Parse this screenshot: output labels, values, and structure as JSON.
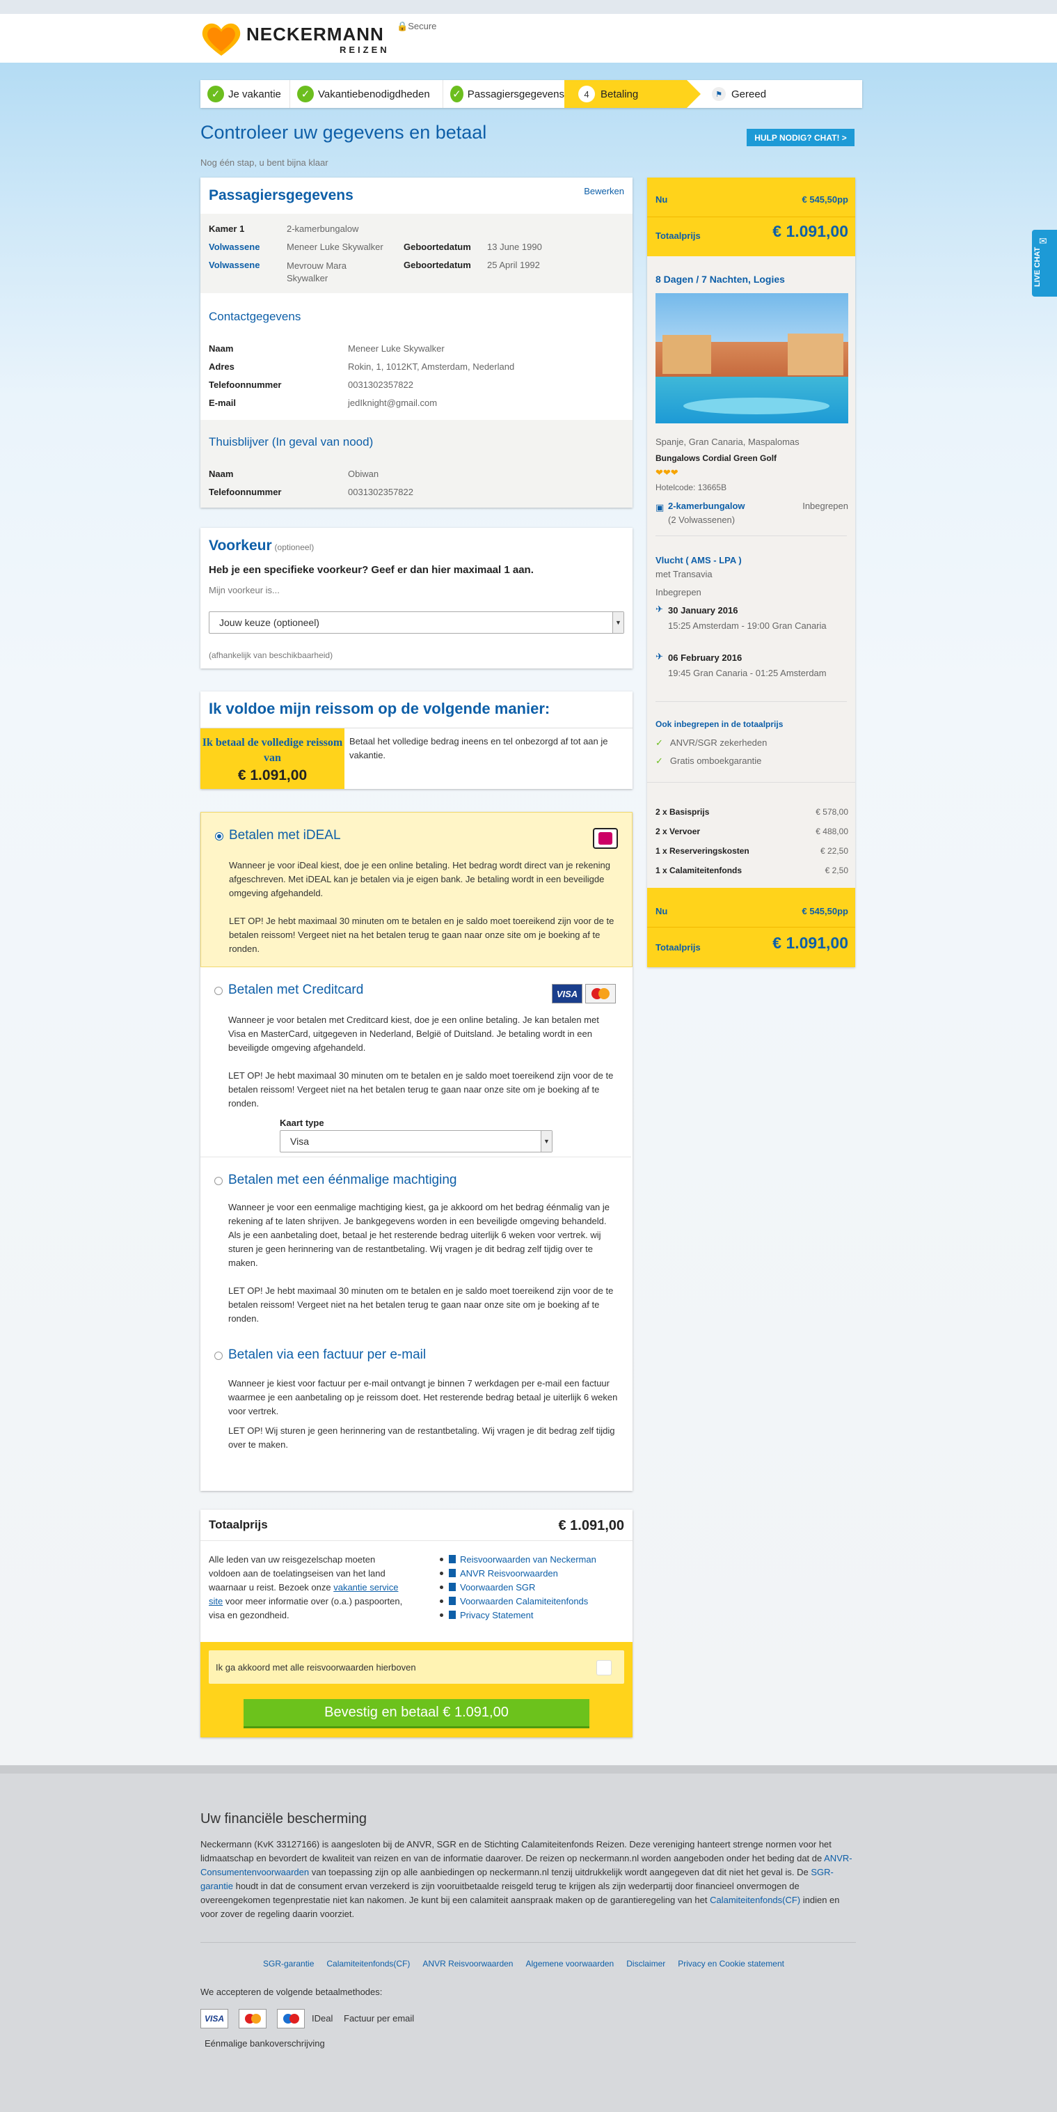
{
  "header": {
    "brand": "NECKERMANN",
    "brand_sub": "REIZEN",
    "secure": "Secure"
  },
  "steps": [
    {
      "label": "Je vakantie",
      "state": "done"
    },
    {
      "label": "Vakantiebenodigdheden",
      "state": "done"
    },
    {
      "label": "Passagiersgegevens",
      "state": "done"
    },
    {
      "label": "Betaling",
      "state": "active",
      "number": "4"
    },
    {
      "label": "Gereed",
      "state": "todo"
    }
  ],
  "page": {
    "title": "Controleer uw gegevens en betaal",
    "subtitle": "Nog één stap, u bent bijna klaar",
    "help": "HULP NODIG? CHAT! >"
  },
  "passengers": {
    "title": "Passagiersgegevens",
    "edit": "Bewerken",
    "room_label": "Kamer 1",
    "room_value": "2-kamerbungalow",
    "rows": [
      {
        "type": "Volwassene",
        "name": "Meneer Luke Skywalker",
        "dob_label": "Geboortedatum",
        "dob": "13 June 1990"
      },
      {
        "type": "Volwassene",
        "name": "Mevrouw Mara Skywalker",
        "dob_label": "Geboortedatum",
        "dob": "25 April 1992"
      }
    ],
    "contact_title": "Contactgegevens",
    "contact": [
      {
        "label": "Naam",
        "value": "Meneer Luke Skywalker"
      },
      {
        "label": "Adres",
        "value": "Rokin, 1, 1012KT, Amsterdam, Nederland"
      },
      {
        "label": "Telefoonnummer",
        "value": "0031302357822"
      },
      {
        "label": "E-mail",
        "value": "jedIknight@gmail.com"
      }
    ],
    "home_title": "Thuisblijver (In geval van nood)",
    "home": [
      {
        "label": "Naam",
        "value": "Obiwan"
      },
      {
        "label": "Telefoonnummer",
        "value": "0031302357822"
      }
    ]
  },
  "preference": {
    "title": "Voorkeur",
    "optional": "(optioneel)",
    "question": "Heb je een specifieke voorkeur? Geef er dan hier maximaal 1 aan.",
    "label": "Mijn voorkeur is...",
    "select": "Jouw keuze (optioneel)",
    "note": "(afhankelijk van beschikbaarheid)"
  },
  "fulfil": {
    "title": "Ik voldoe mijn reissom op de volgende manier:",
    "option_title": "Ik betaal de volledige reissom van",
    "option_amount": "€ 1.091,00",
    "option_text": "Betaal het volledige bedrag ineens en tel onbezorgd af tot aan je vakantie."
  },
  "payments": [
    {
      "title": "Betalen met iDEAL",
      "selected": true,
      "icon": "ideal-logo",
      "p1": "Wanneer je voor iDeal kiest, doe je een online betaling. Het bedrag wordt direct van je rekening afgeschreven. Met iDEAL kan je betalen via je eigen bank. Je betaling wordt in een beveiligde omgeving afgehandeld.",
      "p2": "LET OP! Je hebt maximaal 30 minuten om te betalen en je saldo moet toereikend zijn voor de te betalen reissom! Vergeet niet na het betalen terug te gaan naar onze site om je boeking af te ronden."
    },
    {
      "title": "Betalen met Creditcard",
      "selected": false,
      "icon": "visa-mastercard-logos",
      "p1": "Wanneer je voor betalen met Creditcard kiest, doe je een online betaling. Je kan betalen met Visa en MasterCard, uitgegeven in Nederland, België of Duitsland. Je betaling wordt in een beveiligde omgeving afgehandeld.",
      "p2": "LET OP! Je hebt maximaal 30 minuten om te betalen en je saldo moet toereikend zijn voor de te betalen reissom! Vergeet niet na het betalen terug te gaan naar onze site om je boeking af te ronden.",
      "card_label": "Kaart type",
      "card_value": "Visa"
    },
    {
      "title": "Betalen met een éénmalige machtiging",
      "selected": false,
      "p1": "Wanneer je voor een eenmalige machtiging kiest, ga je akkoord om het bedrag éénmalig van je rekening af te laten shrijven. Je bankgegevens worden in een beveiligde omgeving behandeld. Als je een aanbetaling doet, betaal je het resterende bedrag uiterlijk 6 weken voor vertrek. wij sturen je geen herinnering van de restantbetaling. Wij vragen je dit bedrag zelf tijdig over te maken.",
      "p2": "LET OP! Je hebt maximaal 30 minuten om te betalen en je saldo moet toereikend zijn voor de te betalen reissom! Vergeet niet na het betalen terug te gaan naar onze site om je boeking af te ronden."
    },
    {
      "title": "Betalen via een factuur per e-mail",
      "selected": false,
      "p1": "Wanneer je kiest voor factuur per e-mail ontvangt je binnen 7 werkdagen per e-mail een factuur waarmee je een aanbetaling op je reissom doet. Het resterende bedrag betaal je uiterlijk 6 weken voor vertrek.",
      "p2": "LET OP! Wij sturen je geen herinnering van de restantbetaling. Wij vragen je dit bedrag zelf tijdig over te maken."
    }
  ],
  "total": {
    "label": "Totaalprijs",
    "amount": "€ 1.091,00",
    "text_before": "Alle leden van uw reisgezelschap moeten voldoen aan de toelatingseisen van het land waarnaar u reist. Bezoek onze ",
    "text_link": "vakantie service site",
    "text_after": " voor meer informatie over (o.a.) paspoorten, visa en gezondheid.",
    "links": [
      "Reisvoorwaarden van Neckerman",
      "ANVR Reisvoorwaarden",
      "Voorwaarden SGR",
      "Voorwaarden Calamiteitenfonds",
      "Privacy Statement"
    ],
    "agree": "Ik ga akkoord met alle reisvoorwaarden hierboven",
    "confirm": "Bevestig en betaal € 1.091,00"
  },
  "sidebar": {
    "nu_label": "Nu",
    "nu_value": "€ 545,50pp",
    "total_label": "Totaalprijs",
    "total_value": "€ 1.091,00",
    "trip_title": "8 Dagen / 7 Nachten, Logies",
    "location": "Spanje, Gran Canaria, Maspalomas",
    "hotel": "Bungalows Cordial Green Golf",
    "stars": 3,
    "hotelcode": "Hotelcode: 13665B",
    "room": "2-kamerbungalow",
    "room_sub": "(2 Volwassenen)",
    "room_incl": "Inbegrepen",
    "flight_title": "Vlucht ( AMS - LPA )",
    "flight_carrier": "met Transavia",
    "flight_incl": "Inbegrepen",
    "flights": [
      {
        "date": "30 January 2016",
        "detail": "15:25 Amsterdam - 19:00 Gran Canaria"
      },
      {
        "date": "06 February 2016",
        "detail": "19:45 Gran Canaria - 01:25 Amsterdam"
      }
    ],
    "included_title": "Ook inbegrepen in de totaalprijs",
    "included": [
      "ANVR/SGR zekerheden",
      "Gratis omboekgarantie"
    ],
    "costs": [
      {
        "label": "2 x Basisprijs",
        "value": "€ 578,00"
      },
      {
        "label": "2 x Vervoer",
        "value": "€ 488,00"
      },
      {
        "label": "1 x Reserveringskosten",
        "value": "€ 22,50"
      },
      {
        "label": "1 x Calamiteitenfonds",
        "value": "€ 2,50"
      }
    ]
  },
  "live_chat": "LIVE CHAT",
  "footer": {
    "title": "Uw financiële bescherming",
    "p_1": "Neckermann (KvK 33127166) is aangesloten bij de ANVR, SGR en de Stichting Calamiteitenfonds Reizen. Deze vereniging hanteert strenge normen voor het lidmaatschap en bevordert de kwaliteit van reizen en van de informatie daarover. De reizen op neckermann.nl worden aangeboden onder het beding dat de ",
    "link_1": "ANVR-Consumentenvoorwaarden",
    "p_2": " van toepassing zijn op alle aanbiedingen op neckermann.nl tenzij uitdrukkelijk wordt aangegeven dat dit niet het geval is. De ",
    "link_2": "SGR-garantie",
    "p_3": " houdt in dat de consument ervan verzekerd is zijn vooruitbetaalde reisgeld terug te krijgen als zijn wederpartij door financieel onvermogen de overeengekomen tegenprestatie niet kan nakomen. Je kunt bij een calamiteit aanspraak maken op de garantieregeling van het ",
    "link_3": "Calamiteitenfonds(CF)",
    "p_4": " indien en voor zover de regeling daarin voorziet.",
    "links": [
      "SGR-garantie",
      "Calamiteitenfonds(CF)",
      "ANVR Reisvoorwaarden",
      "Algemene voorwaarden",
      "Disclaimer",
      "Privacy en Cookie statement"
    ],
    "accept": "We accepteren de volgende betaalmethodes:",
    "method_ideal": "IDeal",
    "method_factuur": "Factuur per email",
    "method_eenmalig": "Eénmalige bankoverschrijving",
    "logos": {
      "visa": "VISA",
      "mastercard": "MasterCard",
      "maestro": "Maestro"
    }
  }
}
